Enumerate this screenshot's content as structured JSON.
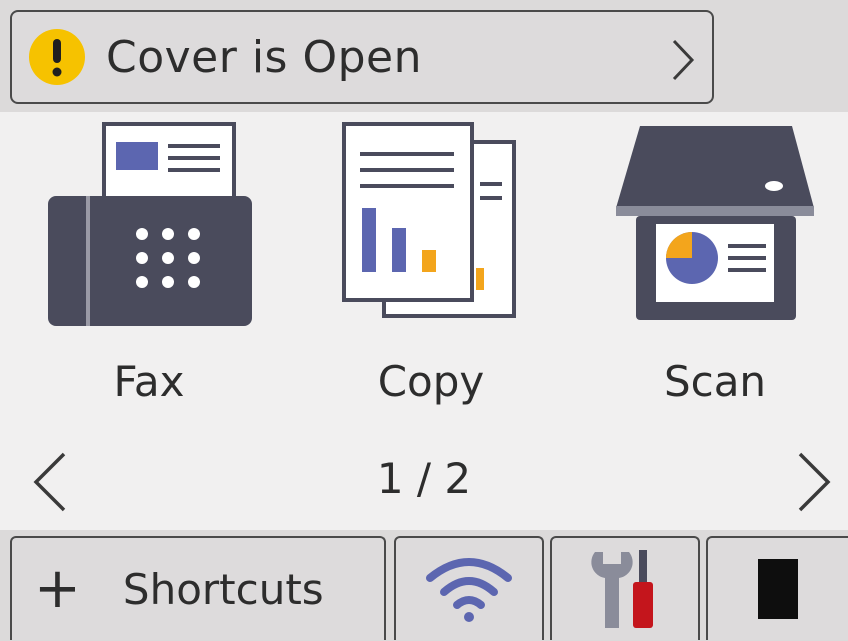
{
  "status": {
    "text": "Cover is Open",
    "warning_color": "#f6c200"
  },
  "apps": [
    {
      "label": "Fax",
      "icon": "fax-icon"
    },
    {
      "label": "Copy",
      "icon": "copy-icon"
    },
    {
      "label": "Scan",
      "icon": "scan-icon"
    }
  ],
  "pager": {
    "text": "1 / 2"
  },
  "bottom": {
    "plus": "+",
    "shortcuts_label": "Shortcuts",
    "wifi_icon": "wifi-icon",
    "tools_icon": "tools-icon",
    "toner_icon": "toner-icon"
  },
  "colors": {
    "accent_blue": "#5c66b0",
    "accent_orange": "#f3a51c",
    "device_dark": "#4a4b5c",
    "tool_red": "#c4151c"
  }
}
